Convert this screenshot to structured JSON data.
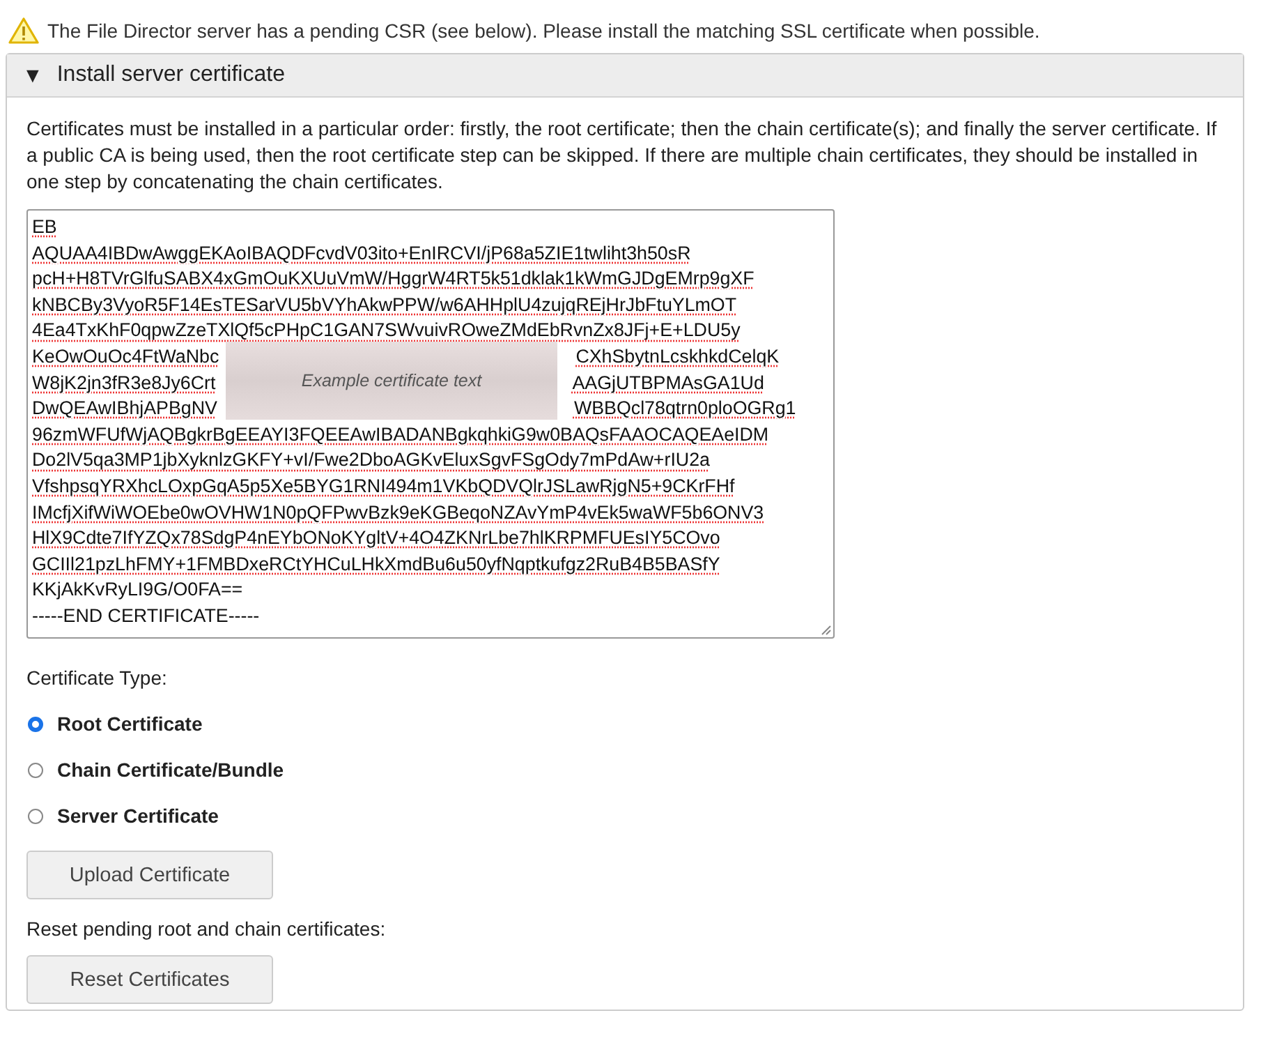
{
  "warning": "The File Director server has a pending CSR (see below). Please install the matching SSL certificate when possible.",
  "panel": {
    "title": "Install server certificate",
    "expanded": true,
    "toggle": "▼",
    "intro": "Certificates must be installed in a particular order: firstly, the root certificate; then the chain certificate(s); and finally the server certificate. If a public CA is being used, then the root certificate step can be skipped. If there are multiple chain certificates, they should be installed in one step by concatenating the chain certificates.",
    "certificate": {
      "blur_label": "Example certificate text",
      "lines": [
        {
          "text": "EB",
          "flagged": true
        },
        {
          "text": "AQUAA4IBDwAwggEKAoIBAQDFcvdV03ito+EnIRCVI/jP68a5ZIE1twliht3h50sR",
          "flagged": true
        },
        {
          "text": "pcH+H8TVrGlfuSABX4xGmOuKXUuVmW/HggrW4RT5k51dklak1kWmGJDgEMrp9gXF",
          "flagged": true
        },
        {
          "text": "kNBCBy3VyoR5F14EsTESarVU5bVYhAkwPPW/w6AHHplU4zujqREjHrJbFtuYLmOT",
          "flagged": true
        },
        {
          "text": "4Ea4TxKhF0qpwZzeTXlQf5cPHpC1GAN7SWvuivROweZMdEbRvnZx8JFj+E+LDU5y",
          "flagged": true
        },
        {
          "left": "KeOwOuOc4FtWaNbc",
          "right": "CXhSbytnLcskhkdCelqK",
          "flagged": true
        },
        {
          "left": "W8jK2jn3fR3e8Jy6Crt",
          "right": "AAGjUTBPMAsGA1Ud",
          "flagged": true
        },
        {
          "left": "DwQEAwIBhjAPBgNV",
          "right": "WBBQcl78qtrn0ploOGRg1",
          "flagged": true
        },
        {
          "text": "96zmWFUfWjAQBgkrBgEEAYI3FQEEAwIBADANBgkqhkiG9w0BAQsFAAOCAQEAeIDM",
          "flagged": true
        },
        {
          "text": "Do2lV5qa3MP1jbXyknlzGKFY+vI/Fwe2DboAGKvEluxSgvFSgOdy7mPdAw+rIU2a",
          "flagged": true
        },
        {
          "text": "VfshpsqYRXhcLOxpGqA5p5Xe5BYG1RNI494m1VKbQDVQlrJSLawRjgN5+9CKrFHf",
          "flagged": true
        },
        {
          "text": "IMcfjXifWiWOEbe0wOVHW1N0pQFPwvBzk9eKGBeqoNZAvYmP4vEk5waWF5b6ONV3",
          "flagged": true
        },
        {
          "text": "HlX9Cdte7IfYZQx78SdgP4nEYbONoKYgltV+4O4ZKNrLbe7hlKRPMFUEsIY5COvo",
          "flagged": true
        },
        {
          "text": "GCIIl21pzLhFMY+1FMBDxeRCtYHCuLHkXmdBu6u50yfNqptkufgz2RuB4B5BASfY",
          "flagged": true
        },
        {
          "text": "KKjAkKvRyLI9G/O0FA==",
          "flagged": false
        },
        {
          "text": "-----END CERTIFICATE-----",
          "flagged": false
        }
      ]
    },
    "type_label": "Certificate Type:",
    "types": [
      {
        "label": "Root Certificate",
        "selected": true
      },
      {
        "label": "Chain Certificate/Bundle",
        "selected": false
      },
      {
        "label": "Server Certificate",
        "selected": false
      }
    ],
    "upload_button": "Upload Certificate",
    "reset_label": "Reset pending root and chain certificates:",
    "reset_button": "Reset Certificates"
  }
}
